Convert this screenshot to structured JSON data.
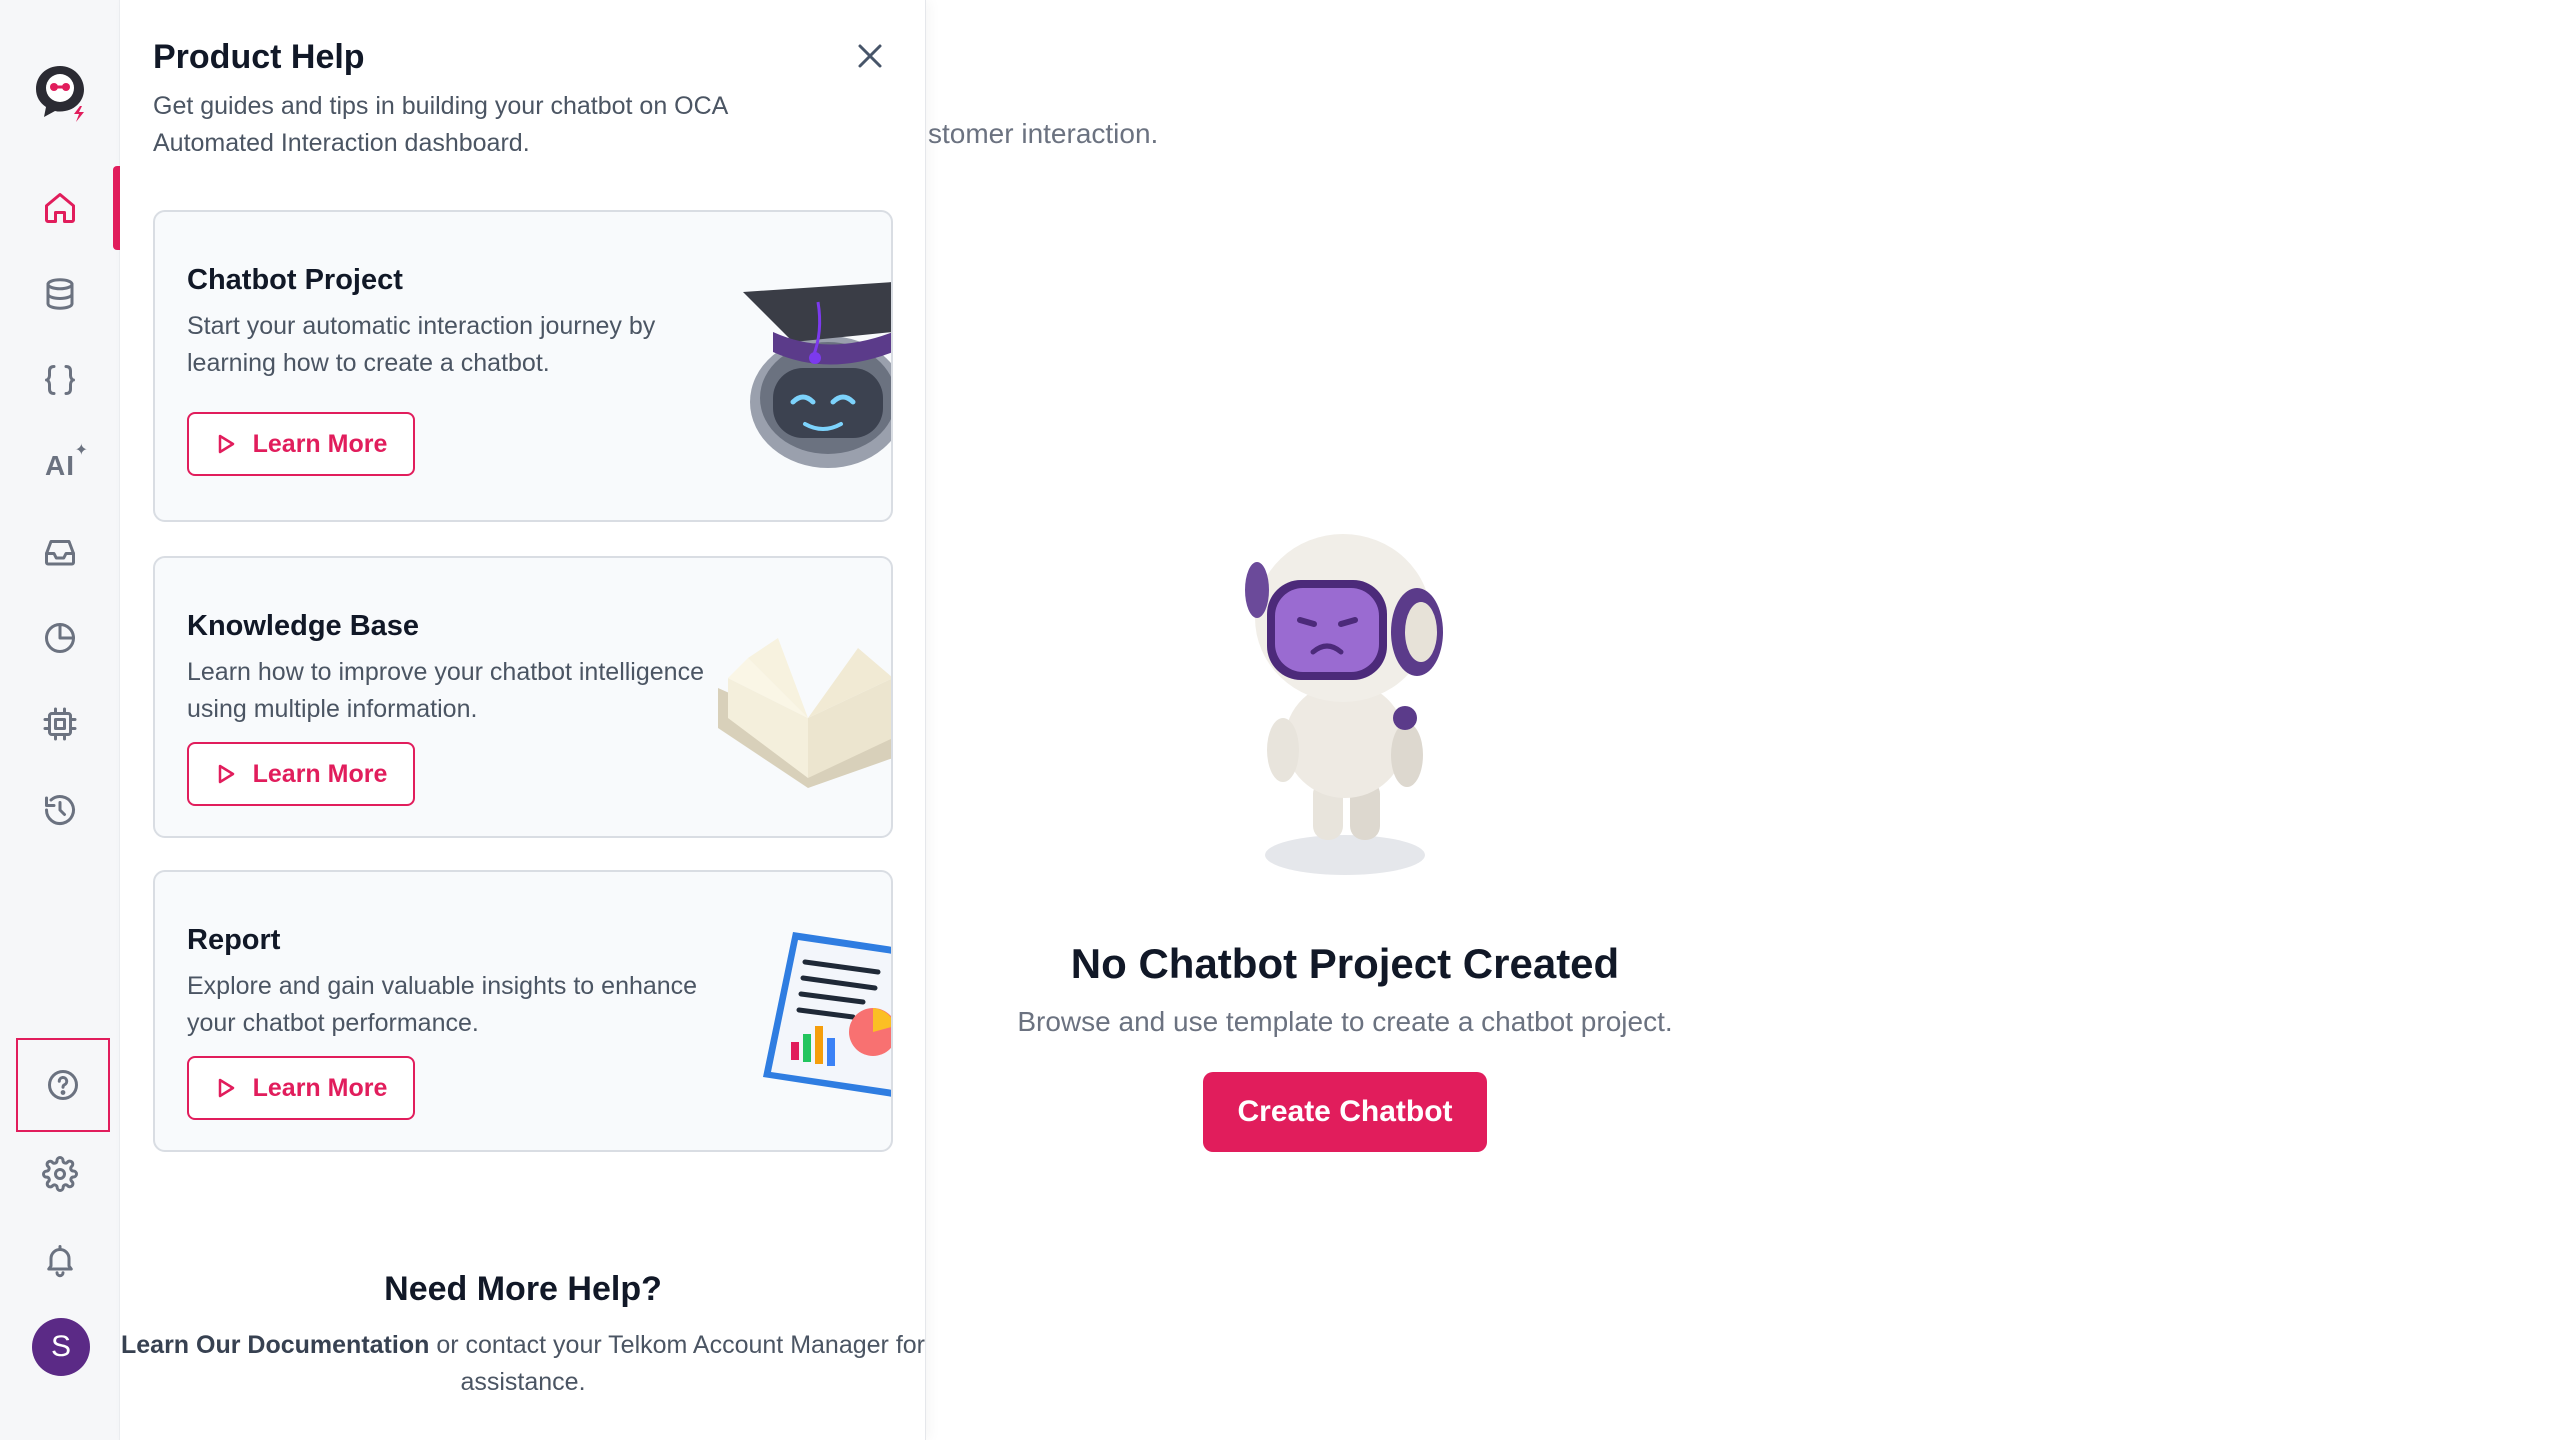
{
  "sidebar": {
    "avatar_initial": "S",
    "accent_color": "#e11d5c",
    "icons": [
      "logo-icon",
      "home-icon",
      "database-icon",
      "code-braces-icon",
      "ai-sparkle-icon",
      "inbox-icon",
      "pie-chart-icon",
      "chip-icon",
      "history-icon",
      "help-icon",
      "settings-icon",
      "bell-icon"
    ],
    "ai_label": "AI"
  },
  "main": {
    "subtitle_partial": "stomer interaction.",
    "empty_title": "No Chatbot Project Created",
    "empty_subtitle": "Browse and use template to create a chatbot project.",
    "create_button": "Create Chatbot"
  },
  "help_panel": {
    "title": "Product Help",
    "description": "Get guides and tips in building your chatbot on OCA Automated Interaction dashboard.",
    "cards": [
      {
        "title": "Chatbot Project",
        "description": "Start your automatic interaction journey by learning how to create a chatbot.",
        "button": "Learn More"
      },
      {
        "title": "Knowledge Base",
        "description": "Learn how to improve your chatbot intelligence using multiple information.",
        "button": "Learn More"
      },
      {
        "title": "Report",
        "description": "Explore and gain valuable insights to enhance your chatbot performance.",
        "button": "Learn More"
      }
    ],
    "more_help": {
      "title": "Need More Help?",
      "link_text": "Learn Our Documentation",
      "rest_text": " or contact your Telkom Account Manager for assistance."
    }
  }
}
